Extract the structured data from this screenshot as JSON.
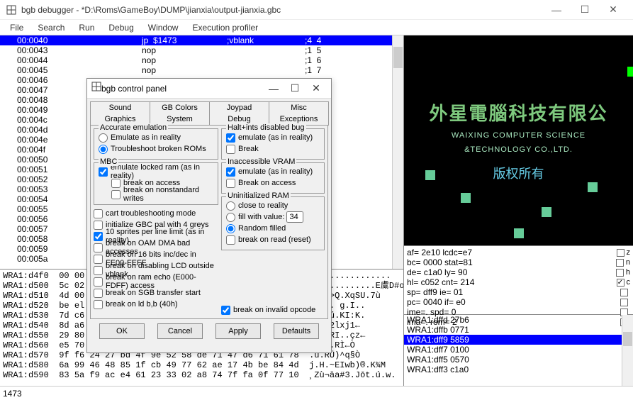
{
  "window": {
    "title": "bgb debugger - *D:\\Roms\\GameBoy\\DUMP\\jianxia\\output-jianxia.gbc"
  },
  "menu": [
    "File",
    "Search",
    "Run",
    "Debug",
    "Window",
    "Execution profiler"
  ],
  "disasm": [
    {
      "addr": "00:0040",
      "op": "jp",
      "arg": "$1473",
      "comment": ";vblank",
      "trail": ";4  4",
      "sel": true
    },
    {
      "addr": "00:0043",
      "op": "nop",
      "arg": "",
      "comment": "",
      "trail": ";1  5"
    },
    {
      "addr": "00:0044",
      "op": "nop",
      "arg": "",
      "comment": "",
      "trail": ";1  6"
    },
    {
      "addr": "00:0045",
      "op": "nop",
      "arg": "",
      "comment": "",
      "trail": ";1  7"
    },
    {
      "addr": "00:0046",
      "op": "",
      "arg": "",
      "comment": "",
      "trail": ""
    },
    {
      "addr": "00:0047",
      "op": "",
      "arg": "",
      "comment": "",
      "trail": ""
    },
    {
      "addr": "00:0048",
      "op": "",
      "arg": "",
      "comment": "",
      "trail": ""
    },
    {
      "addr": "00:0049",
      "op": "",
      "arg": "",
      "comment": "",
      "trail": ""
    },
    {
      "addr": "00:004c",
      "op": "",
      "arg": "",
      "comment": "",
      "trail": ""
    },
    {
      "addr": "00:004d",
      "op": "",
      "arg": "",
      "comment": "",
      "trail": ""
    },
    {
      "addr": "00:004e",
      "op": "",
      "arg": "",
      "comment": "",
      "trail": ""
    },
    {
      "addr": "00:004f",
      "op": "",
      "arg": "",
      "comment": "",
      "trail": ""
    },
    {
      "addr": "00:0050",
      "op": "",
      "arg": "",
      "comment": "",
      "trail": ""
    },
    {
      "addr": "00:0051",
      "op": "",
      "arg": "",
      "comment": "",
      "trail": ""
    },
    {
      "addr": "00:0052",
      "op": "",
      "arg": "",
      "comment": "",
      "trail": ""
    },
    {
      "addr": "00:0053",
      "op": "",
      "arg": "",
      "comment": "",
      "trail": ""
    },
    {
      "addr": "00:0054",
      "op": "",
      "arg": "",
      "comment": "",
      "trail": ""
    },
    {
      "addr": "00:0055",
      "op": "",
      "arg": "",
      "comment": "",
      "trail": ""
    },
    {
      "addr": "00:0056",
      "op": "",
      "arg": "",
      "comment": "",
      "trail": ""
    },
    {
      "addr": "00:0057",
      "op": "",
      "arg": "",
      "comment": "",
      "trail": ""
    },
    {
      "addr": "00:0058",
      "op": "",
      "arg": "",
      "comment": "",
      "trail": ""
    },
    {
      "addr": "00:0059",
      "op": "",
      "arg": "",
      "comment": "",
      "trail": ""
    },
    {
      "addr": "00:005a",
      "op": "",
      "arg": "",
      "comment": "",
      "trail": ""
    }
  ],
  "hexdump": [
    "WRA1:d4f0  00 00 00 00 00 00 00 00 00 00 00 00 00 00 00 00  ................",
    "WRA1:d500  5c 02 00 01 00 00 00 00 00 00 00 00 00 00 00 00  \\............E鬳D#o.◊lō",
    "WRA1:d510  4d 00 00 00 00 00 00 00 00 00 00 00 00 00 00 00  M..o>Q.XqSU.7ù",
    "WRA1:d520  be el 00 00 00 00 00 00 00 00 00 00 00 00 00 00  ¾á^W. g.I..",
    "WRA1:d530  7d c6 00 00 00 00 00 00 00 00 00 00 00 00 00 00  žBā.ú.KI:K.",
    "WRA1:d540  8d a6 00 00 00 00 00 00 00 00 00 00 00 00 00 00  .Ò.½2lxj1←",
    "WRA1:d550  29 80 00 00 00 00 00 00 00 00 00 00 00 00 00 00  ĥ½(PRI..çz←",
    "WRA1:d560  e5 70 00 00 00 00 00 00 00 00 00 00 00 00 00 00  žâ.ß.RÌ←Ò",
    "WRA1:d570  9f f6 24 27 bd 4f 9e 52 58 de 71 47 d6 71 61 78  .ù.RÜ)^q§Ò",
    "WRA1:d580  6a 99 46 48 85 1f cb 49 77 62 ae 17 4b be 84 4d  j.H.~EIwb)®.K¾M",
    "WRA1:d590  83 5a f9 ac e4 61 23 33 02 a8 74 7f fa 0f 77 10  ¸Zù¬äa#3.Jōt.ú.w."
  ],
  "emu_text": {
    "line1": "外星電腦科技有限公",
    "line2a": "WAIXING COMPUTER SCIENCE",
    "line2b": "&TECHNOLOGY CO.,LTD.",
    "line3": "版权所有"
  },
  "regs": {
    "lines": [
      "af= 2e10  lcdc=e7",
      "bc= 0000  stat=81",
      "de= c1a0  ly=   90",
      "hl= c052  cnt= 214",
      "sp= dff9  ie=   01",
      "pc= 0040  if=   e0",
      "ime=.     spd=  0",
      "ima=.     rom=  2"
    ],
    "checks": [
      "z",
      "n",
      "h",
      "c",
      "",
      "",
      "",
      ""
    ]
  },
  "stack": [
    {
      "t": "WRA1:dffd 27b6"
    },
    {
      "t": "WRA1:dffb 0771"
    },
    {
      "t": "WRA1:dff9 5859",
      "sel": true
    },
    {
      "t": "WRA1:dff7 0100"
    },
    {
      "t": "WRA1:dff5 0570"
    },
    {
      "t": "WRA1:dff3 c1a0"
    }
  ],
  "status": "1473",
  "panel": {
    "title": "bgb control panel",
    "tabs1": [
      "Sound",
      "GB Colors",
      "Joypad",
      "Misc"
    ],
    "tabs2": [
      "Graphics",
      "System",
      "Debug",
      "Exceptions"
    ],
    "active_tab": "Exceptions",
    "accurate_emu": {
      "legend": "Accurate emulation",
      "r1": "Emulate as in reality",
      "r2": "Troubleshoot broken ROMs"
    },
    "mbc": {
      "legend": "MBC",
      "c1": "emulate locked ram (as in reality)",
      "c2": "break on access",
      "c3": "break on nonstandard writes"
    },
    "halt": {
      "legend": "Halt+ints disabled bug",
      "c1": "emulate (as in reality)",
      "c2": "Break"
    },
    "vram": {
      "legend": "Inaccessible VRAM",
      "c1": "emulate (as in reality)",
      "c2": "Break on access"
    },
    "uninit": {
      "legend": "Uninitialized RAM",
      "r1": "close to reality",
      "r2": "fill with value:",
      "fillval": "34",
      "r3": "Random filled",
      "c1": "break on read (reset)"
    },
    "longs": [
      {
        "t": "cart troubleshooting mode",
        "on": false
      },
      {
        "t": "initialize GBC pal with 4 greys",
        "on": false
      },
      {
        "t": "10 sprites per line limit (as in reality)",
        "on": true
      },
      {
        "t": "break on OAM DMA bad accesses",
        "on": false
      },
      {
        "t": "break on 16 bits inc/dec in FE00-FEFF",
        "on": false
      },
      {
        "t": "break on disabling LCD outside vblank",
        "on": false
      },
      {
        "t": "break on ram echo (E000-FDFF) access",
        "on": false
      },
      {
        "t": "break on SGB transfer start",
        "on": false
      },
      {
        "t": "break on ld b,b (40h)",
        "on": false
      }
    ],
    "invalid_opcode": "break on invalid opcode",
    "buttons": {
      "ok": "OK",
      "cancel": "Cancel",
      "apply": "Apply",
      "defaults": "Defaults"
    }
  }
}
